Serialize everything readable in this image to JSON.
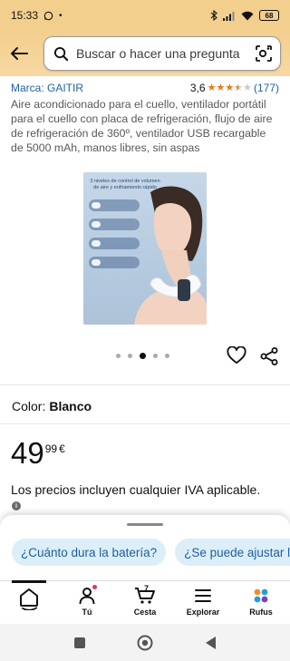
{
  "status_bar": {
    "time": "15:33",
    "battery": "68"
  },
  "search": {
    "placeholder": "Buscar o hacer una pregunta"
  },
  "product": {
    "brand": "Marca: GAITIR",
    "rating_value": "3,6",
    "rating": 3.6,
    "review_count": "(177)",
    "title": "Aire acondicionado para el cuello, ventilador portátil para el cuello con placa de refrigeración, flujo de aire de refrigeración de 360º, ventilador USB recargable de 5000 mAh, manos libres, sin aspas",
    "image_caption": "3 niveles de control de volumen de aire y enfriamiento rápido",
    "carousel": {
      "total": 5,
      "active": 3
    },
    "color_label": "Color:",
    "color_value": "Blanco",
    "price_whole": "49",
    "price_fraction": "99",
    "price_currency": "€",
    "tax_note": "Los precios incluyen cualquier IVA aplicable.",
    "info_icon": "i"
  },
  "rufus_chips": [
    "¿Cuánto dura la batería?",
    "¿Se puede ajustar la"
  ],
  "tabs": [
    {
      "label": "",
      "icon": "home-icon"
    },
    {
      "label": "Tú",
      "icon": "user-icon"
    },
    {
      "label": "Cesta",
      "icon": "cart-icon",
      "count": "7"
    },
    {
      "label": "Explorar",
      "icon": "menu-icon"
    },
    {
      "label": "Rufus",
      "icon": "rufus-icon"
    }
  ],
  "colors": {
    "header": "#f3cf8e",
    "link": "#2162a1",
    "star": "#e47911",
    "chip_bg": "#dceef8"
  }
}
